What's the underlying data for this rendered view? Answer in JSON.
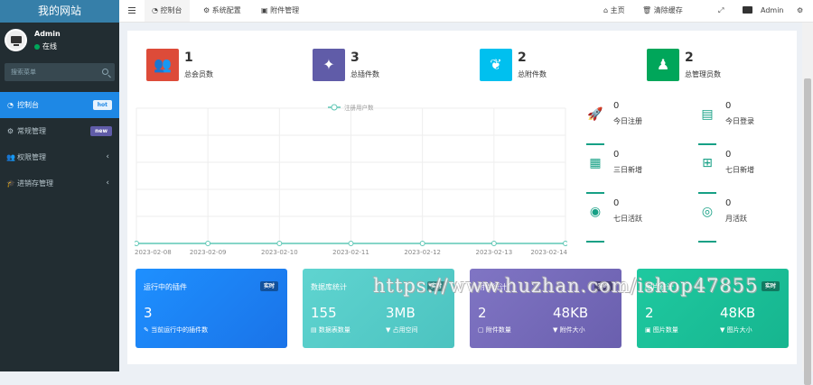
{
  "sidebar": {
    "brand": "我的网站",
    "user": {
      "name": "Admin",
      "status": "在线"
    },
    "search_placeholder": "搜索菜单",
    "items": [
      {
        "label": "控制台",
        "badge": "hot",
        "icon": "dashboard-icon",
        "active": true
      },
      {
        "label": "常规管理",
        "badge": "new",
        "icon": "cogs-icon"
      },
      {
        "label": "权限管理",
        "icon": "group-icon",
        "chevron": "‹"
      },
      {
        "label": "进销存管理",
        "icon": "graduation-cap-icon",
        "chevron": "‹"
      }
    ]
  },
  "topbar": {
    "tabs": [
      {
        "label": "控制台",
        "icon": "dashboard-icon",
        "active": true
      },
      {
        "label": "系统配置",
        "icon": "gear-icon"
      },
      {
        "label": "附件管理",
        "icon": "file-image-icon"
      }
    ],
    "right": [
      {
        "label": "主页",
        "icon": "home-icon"
      },
      {
        "label": "清除缓存",
        "icon": "trash-icon"
      },
      {
        "label": "",
        "icon": "expand-icon"
      },
      {
        "label": "Admin",
        "icon": "avatar"
      },
      {
        "label": "",
        "icon": "gears-icon"
      }
    ]
  },
  "stats": [
    {
      "value": "1",
      "label": "总会员数",
      "color": "#dd4b39",
      "icon": "users-icon"
    },
    {
      "value": "3",
      "label": "总插件数",
      "color": "#605ca8",
      "icon": "magic-icon"
    },
    {
      "value": "2",
      "label": "总附件数",
      "color": "#00c0ef",
      "icon": "leaf-icon"
    },
    {
      "value": "2",
      "label": "总管理员数",
      "color": "#00a65a",
      "icon": "user-icon"
    }
  ],
  "chart_data": {
    "type": "line",
    "legend": [
      "注册用户数"
    ],
    "categories": [
      "2023-02-08",
      "2023-02-09",
      "2023-02-10",
      "2023-02-11",
      "2023-02-12",
      "2023-02-13",
      "2023-02-14"
    ],
    "series": [
      {
        "name": "注册用户数",
        "values": [
          0,
          0,
          0,
          0,
          0,
          0,
          0
        ]
      }
    ],
    "legend_position": "top-center",
    "grid": true,
    "color": "#5ec7b5"
  },
  "mini_stats": [
    {
      "value": "0",
      "label": "今日注册",
      "icon": "rocket-icon"
    },
    {
      "value": "0",
      "label": "今日登录",
      "icon": "vcard-icon"
    },
    {
      "value": "0",
      "label": "三日新增",
      "icon": "calendar-icon"
    },
    {
      "value": "0",
      "label": "七日新增",
      "icon": "calendar-plus-icon"
    },
    {
      "value": "0",
      "label": "七日活跃",
      "icon": "user-circle-icon"
    },
    {
      "value": "0",
      "label": "月活跃",
      "icon": "user-circle-o-icon"
    }
  ],
  "cards": [
    {
      "title": "运行中的插件",
      "tag": "实时",
      "color": "#1e88e5",
      "values": [
        {
          "v": "3",
          "l": "当前运行中的插件数"
        }
      ]
    },
    {
      "title": "数据库统计",
      "tag": "实时",
      "color": "#4fd1c5",
      "values": [
        {
          "v": "155",
          "l": "数据表数量"
        },
        {
          "v": "3MB",
          "l": "占用空间"
        }
      ]
    },
    {
      "title": "附件统计",
      "tag": "实时",
      "color": "#7b6fb4",
      "values": [
        {
          "v": "2",
          "l": "附件数量"
        },
        {
          "v": "48KB",
          "l": "附件大小"
        }
      ]
    },
    {
      "title": "图片统计",
      "tag": "实时",
      "color": "#1abc9c",
      "values": [
        {
          "v": "2",
          "l": "图片数量"
        },
        {
          "v": "48KB",
          "l": "图片大小"
        }
      ]
    }
  ],
  "watermark": "https://www.huzhan.com/ishop47855"
}
